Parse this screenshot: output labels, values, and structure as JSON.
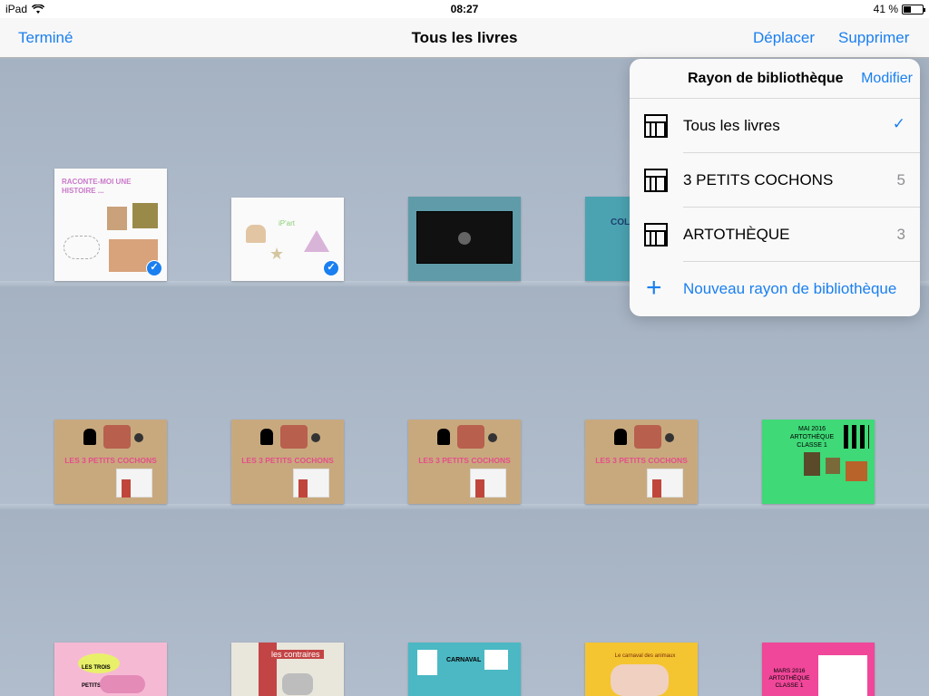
{
  "status": {
    "device": "iPad",
    "time": "08:27",
    "battery": "41 %"
  },
  "nav": {
    "title": "Tous les livres",
    "done": "Terminé",
    "move": "Déplacer",
    "delete": "Supprimer"
  },
  "books": {
    "row1": [
      {
        "title": "RACONTE-MOI UNE HISTOIRE ...",
        "selected": true
      },
      {
        "title": "iP'art",
        "selected": true
      },
      {
        "title": "",
        "selected": false
      },
      {
        "title": "COL... & P...",
        "selected": false
      }
    ],
    "row2": [
      {
        "title": "LES 3 PETITS COCHONS"
      },
      {
        "title": "LES 3 PETITS COCHONS"
      },
      {
        "title": "LES 3 PETITS COCHONS"
      },
      {
        "title": "LES 3 PETITS COCHONS"
      },
      {
        "title": "MAI 2016 ARTOTHÈQUE CLASSE 1"
      }
    ],
    "row3": [
      {
        "title": "LES TROIS PETITS"
      },
      {
        "title": "les contraires"
      },
      {
        "title": "CARNAVAL"
      },
      {
        "title": "Le carnaval des animaux"
      },
      {
        "title": "MARS 2016 ARTOTHÈQUE CLASSE 1"
      }
    ]
  },
  "popover": {
    "title": "Rayon de bibliothèque",
    "edit": "Modifier",
    "items": [
      {
        "label": "Tous les livres",
        "count": "",
        "checked": true
      },
      {
        "label": "3 PETITS COCHONS",
        "count": "5",
        "checked": false
      },
      {
        "label": "ARTOTHÈQUE",
        "count": "3",
        "checked": false
      }
    ],
    "new_shelf": "Nouveau rayon de bibliothèque"
  },
  "progress": {
    "battery_level": 0.41
  },
  "colors": {
    "accent": "#1a7ff0",
    "shelf": "#a9b6c6"
  }
}
